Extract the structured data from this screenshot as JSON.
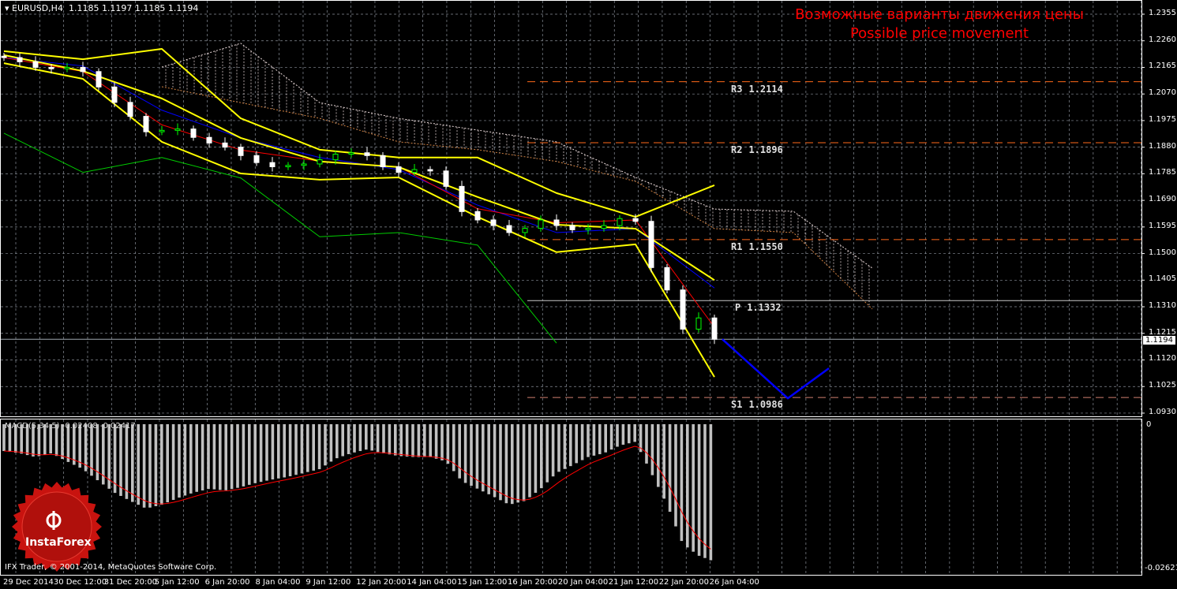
{
  "header": {
    "symbol": "EURUSD,H4",
    "ohlc": "1.1185 1.1197 1.1185 1.1194"
  },
  "title": {
    "ru": "Возможные варианты движения цены",
    "en": "Possible price movement"
  },
  "colors": {
    "background": "#000000",
    "grid": "#8a9099",
    "bull": "#00ff00",
    "bear": "#ffffff",
    "bands": "#ffff00",
    "tenkan": "#ff0000",
    "kijun": "#0000ff",
    "chikou": "#00cc00",
    "forecast": "#0000ff",
    "pivot_res": "#ff6a1a",
    "pivot_p": "#e8e060",
    "histogram": "#c0c0c0",
    "signal": "#ff0000",
    "title": "#ff0000"
  },
  "price_axis": [
    "1.2355",
    "1.2260",
    "1.2165",
    "1.2070",
    "1.1975",
    "1.1880",
    "1.1785",
    "1.1690",
    "1.1595",
    "1.1500",
    "1.1405",
    "1.1310",
    "1.1215",
    "1.1120",
    "1.1025",
    "1.0930"
  ],
  "current_price": "1.1194",
  "time_axis": [
    "29 Dec 2014",
    "30 Dec 12:00",
    "31 Dec 20:00",
    "5 Jan 12:00",
    "6 Jan 20:00",
    "8 Jan 04:00",
    "9 Jan 12:00",
    "12 Jan 20:00",
    "14 Jan 04:00",
    "15 Jan 12:00",
    "16 Jan 20:00",
    "20 Jan 04:00",
    "21 Jan 12:00",
    "22 Jan 20:00",
    "26 Jan 04:00"
  ],
  "pivots": [
    {
      "label": "R3",
      "value": "1.2114",
      "price": 1.2114
    },
    {
      "label": "R2",
      "value": "1.1896",
      "price": 1.1896
    },
    {
      "label": "R1",
      "value": "1.1550",
      "price": 1.155
    },
    {
      "label": "P",
      "value": "1.1332",
      "price": 1.1332
    },
    {
      "label": "S1",
      "value": "1.0986",
      "price": 1.0986
    }
  ],
  "macd": {
    "label": "MACD(5,34,5) -0.02408 -0.02417",
    "axis_top": "0",
    "axis_bottom": "-0.02621"
  },
  "footer": {
    "copyright": "IFX Trader, © 2001-2014, MetaQuotes Software Corp."
  },
  "logo": {
    "text": "InstaForex"
  },
  "chart_data": {
    "type": "candlestick",
    "ylim": [
      1.093,
      1.2355
    ],
    "close": [
      1.22,
      1.2185,
      1.2165,
      1.216,
      1.2165,
      1.215,
      1.2095,
      1.204,
      1.199,
      1.1935,
      1.194,
      1.1945,
      1.1915,
      1.1895,
      1.188,
      1.185,
      1.1825,
      1.181,
      1.1815,
      1.182,
      1.1835,
      1.1855,
      1.186,
      1.185,
      1.181,
      1.179,
      1.18,
      1.1795,
      1.174,
      1.165,
      1.162,
      1.16,
      1.1575,
      1.159,
      1.162,
      1.16,
      1.1585,
      1.159,
      1.16,
      1.1625,
      1.1615,
      1.145,
      1.137,
      1.123,
      1.127,
      1.1194
    ],
    "bollinger_upper": [
      1.2223,
      1.2194,
      1.2231,
      1.1983,
      1.1871,
      1.1843,
      1.1843,
      1.1716,
      1.1631,
      1.1744
    ],
    "bollinger_middle": [
      1.2209,
      1.2152,
      1.2054,
      1.1913,
      1.1829,
      1.1809,
      1.1702,
      1.1603,
      1.1589,
      1.1405
    ],
    "bollinger_lower": [
      1.218,
      1.2124,
      1.1899,
      1.1786,
      1.1764,
      1.1772,
      1.1631,
      1.1505,
      1.1533,
      1.1059
    ],
    "tenkan": [
      1.22,
      1.215,
      1.196,
      1.187,
      1.183,
      1.181,
      1.166,
      1.161,
      1.162,
      1.1237
    ],
    "kijun": [
      1.22,
      1.217,
      1.2012,
      1.1913,
      1.1843,
      1.18,
      1.1673,
      1.1575,
      1.1589,
      1.1377
    ],
    "chikou": [
      1.193,
      1.179,
      1.1843,
      1.177,
      1.156,
      1.1575,
      1.153,
      1.118
    ],
    "cloud_top": [
      1.2166,
      1.2251,
      1.2039,
      1.1983,
      1.1941,
      1.1899,
      1.1772,
      1.1659,
      1.1651,
      1.1448
    ],
    "cloud_bottom": [
      1.2096,
      1.2039,
      1.1983,
      1.1899,
      1.1871,
      1.1829,
      1.1758,
      1.1589,
      1.1575,
      1.1302
    ],
    "forecast": [
      1.1194,
      1.0983,
      1.109
    ],
    "macd_histogram": [
      -0.0049,
      -0.0053,
      -0.006,
      -0.0053,
      -0.0068,
      -0.0082,
      -0.0104,
      -0.0125,
      -0.014,
      -0.0154,
      -0.0147,
      -0.0135,
      -0.0125,
      -0.0118,
      -0.0121,
      -0.0115,
      -0.0107,
      -0.0101,
      -0.0096,
      -0.0089,
      -0.0082,
      -0.0063,
      -0.0053,
      -0.0046,
      -0.0053,
      -0.0058,
      -0.006,
      -0.006,
      -0.0068,
      -0.0104,
      -0.0118,
      -0.0132,
      -0.0147,
      -0.014,
      -0.0118,
      -0.0089,
      -0.0075,
      -0.006,
      -0.0053,
      -0.0039,
      -0.0032,
      -0.0089,
      -0.0147,
      -0.0219,
      -0.024,
      -0.0251
    ],
    "macd_ylim": [
      -0.02621,
      0
    ]
  }
}
